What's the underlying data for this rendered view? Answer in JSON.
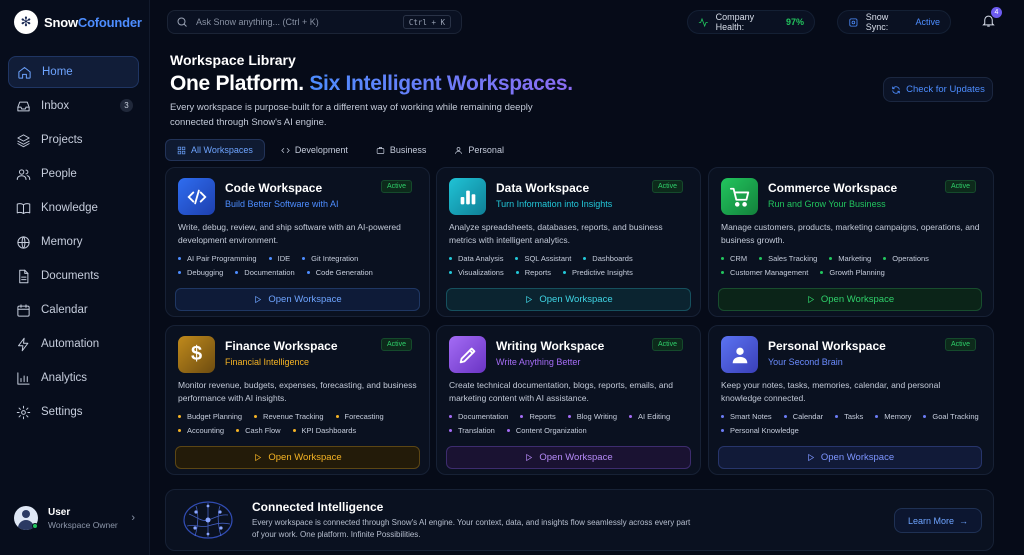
{
  "app": {
    "logo_part1": "Snow",
    "logo_part2": "Cofounder"
  },
  "search": {
    "placeholder": "Ask Snow anything... (Ctrl + K)",
    "shortcut": "Ctrl + K"
  },
  "status": {
    "health_label": "Company Health:",
    "health_value": "97%",
    "sync_label": "Snow Sync:",
    "sync_value": "Active",
    "notification_count": "4"
  },
  "sidebar": {
    "items": [
      {
        "label": "Home",
        "icon": "home-icon"
      },
      {
        "label": "Inbox",
        "icon": "inbox-icon",
        "count": "3"
      },
      {
        "label": "Projects",
        "icon": "layers-icon"
      },
      {
        "label": "People",
        "icon": "people-icon"
      },
      {
        "label": "Knowledge",
        "icon": "book-icon"
      },
      {
        "label": "Memory",
        "icon": "brain-icon"
      },
      {
        "label": "Documents",
        "icon": "document-icon"
      },
      {
        "label": "Calendar",
        "icon": "calendar-icon"
      },
      {
        "label": "Automation",
        "icon": "bolt-icon"
      },
      {
        "label": "Analytics",
        "icon": "chart-icon"
      },
      {
        "label": "Settings",
        "icon": "gear-icon"
      }
    ],
    "user": {
      "name": "User",
      "role": "Workspace Owner"
    }
  },
  "header": {
    "section": "Workspace Library",
    "title_plain": "One Platform.",
    "title_accent": "Six Intelligent Workspaces.",
    "description": "Every workspace is purpose-built for a different way of working while remaining deeply connected through Snow's AI engine.",
    "check_updates": "Check for Updates"
  },
  "tabs": [
    {
      "label": "All Workspaces",
      "icon": "grid-icon"
    },
    {
      "label": "Development",
      "icon": "code-icon"
    },
    {
      "label": "Business",
      "icon": "briefcase-icon"
    },
    {
      "label": "Personal",
      "icon": "person-icon"
    }
  ],
  "workspaces": [
    {
      "title": "Code Workspace",
      "subtitle": "Build Better Software with AI",
      "badge": "Active",
      "description": "Write, debug, review, and ship software with an AI-powered development environment.",
      "features": [
        "AI Pair Programming",
        "IDE",
        "Git Integration",
        "Debugging",
        "Documentation",
        "Code Generation"
      ],
      "button": "Open Workspace",
      "icon": "code-icon",
      "accent": "#4d8dff"
    },
    {
      "title": "Data Workspace",
      "subtitle": "Turn Information into Insights",
      "badge": "Active",
      "description": "Analyze spreadsheets, databases, reports, and business metrics with intelligent analytics.",
      "features": [
        "Data Analysis",
        "SQL Assistant",
        "Dashboards",
        "Visualizations",
        "Reports",
        "Predictive Insights"
      ],
      "button": "Open Workspace",
      "icon": "bar-chart-icon",
      "accent": "#22c7d8"
    },
    {
      "title": "Commerce Workspace",
      "subtitle": "Run and Grow Your Business",
      "badge": "Active",
      "description": "Manage customers, products, marketing campaigns, operations, and business growth.",
      "features": [
        "CRM",
        "Sales Tracking",
        "Marketing",
        "Operations",
        "Customer Management",
        "Growth Planning"
      ],
      "button": "Open Workspace",
      "icon": "cart-icon",
      "accent": "#22c55e"
    },
    {
      "title": "Finance Workspace",
      "subtitle": "Financial Intelligence",
      "badge": "Active",
      "description": "Monitor revenue, budgets, expenses, forecasting, and business performance with AI insights.",
      "features": [
        "Budget Planning",
        "Revenue Tracking",
        "Forecasting",
        "Accounting",
        "Cash Flow",
        "KPI Dashboards"
      ],
      "button": "Open Workspace",
      "icon": "dollar-icon",
      "accent": "#f5b324"
    },
    {
      "title": "Writing Workspace",
      "subtitle": "Write Anything Better",
      "badge": "Active",
      "description": "Create technical documentation, blogs, reports, emails, and marketing content with AI assistance.",
      "features": [
        "Documentation",
        "Reports",
        "Blog Writing",
        "AI Editing",
        "Translation",
        "Content Organization"
      ],
      "button": "Open Workspace",
      "icon": "pen-icon",
      "accent": "#a46cf5"
    },
    {
      "title": "Personal Workspace",
      "subtitle": "Your Second Brain",
      "badge": "Active",
      "description": "Keep your notes, tasks, memories, calendar, and personal knowledge connected.",
      "features": [
        "Smart Notes",
        "Calendar",
        "Tasks",
        "Memory",
        "Goal Tracking",
        "Personal Knowledge"
      ],
      "button": "Open Workspace",
      "icon": "user-icon",
      "accent": "#6b7cf5"
    }
  ],
  "connected": {
    "title": "Connected Intelligence",
    "description": "Every workspace is connected through Snow's AI engine. Your context, data, and insights flow seamlessly across every part of your work. One platform. Infinite Possibilities.",
    "button": "Learn More"
  }
}
